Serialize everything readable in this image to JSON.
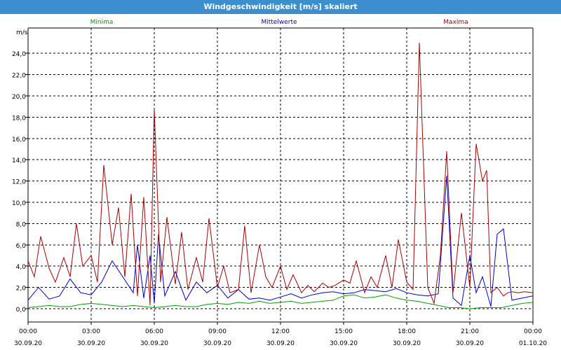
{
  "window": {
    "title": "Windgeschwindigkeit [m/s] skaliert"
  },
  "colors": {
    "minima": "#00a000",
    "mittel": "#0000cc",
    "maxima": "#aa0000"
  },
  "chart_data": {
    "type": "line",
    "title": "Windgeschwindigkeit [m/s] skaliert",
    "ylabel": "m/s",
    "xlabel": "",
    "ylim": [
      0,
      24
    ],
    "y_ticks": [
      "0,0",
      "2,0",
      "4,0",
      "6,0",
      "8,0",
      "10,0",
      "12,0",
      "14,0",
      "16,0",
      "18,0",
      "20,0",
      "22,0",
      "24,0"
    ],
    "x_ticks": [
      {
        "time": "00:00",
        "date": "30.09.20"
      },
      {
        "time": "03:00",
        "date": "30.09.20"
      },
      {
        "time": "06:00",
        "date": "30.09.20"
      },
      {
        "time": "09:00",
        "date": "30.09.20"
      },
      {
        "time": "12:00",
        "date": "30.09.20"
      },
      {
        "time": "15:00",
        "date": "30.09.20"
      },
      {
        "time": "18:00",
        "date": "30.09.20"
      },
      {
        "time": "21:00",
        "date": "30.09.20"
      },
      {
        "time": "00:00",
        "date": "01.10.20"
      }
    ],
    "x_unit": "hours since 30.09.20 00:00",
    "grid": true,
    "series": [
      {
        "name": "Minima",
        "x": [
          0,
          0.5,
          1,
          1.5,
          2,
          2.5,
          3,
          3.5,
          4,
          4.5,
          5,
          5.5,
          6,
          6.5,
          7,
          7.5,
          8,
          8.5,
          9,
          9.5,
          10,
          10.5,
          11,
          11.5,
          12,
          12.5,
          13,
          13.5,
          14,
          14.5,
          15,
          15.5,
          16,
          16.5,
          17,
          17.5,
          18,
          18.5,
          19,
          19.5,
          20,
          20.5,
          21,
          21.5,
          22,
          22.5,
          23,
          23.5,
          24
        ],
        "values": [
          0.1,
          0.2,
          0.3,
          0.2,
          0.2,
          0.4,
          0.5,
          0.4,
          0.3,
          0.2,
          0.3,
          0.2,
          0.1,
          0.2,
          0.3,
          0.2,
          0.2,
          0.4,
          0.5,
          0.4,
          0.6,
          0.5,
          0.7,
          0.5,
          0.6,
          0.7,
          0.5,
          0.6,
          0.7,
          0.8,
          1.2,
          1.3,
          1.0,
          1.1,
          1.3,
          1.0,
          0.8,
          0.7,
          0.5,
          0.3,
          0.1,
          0.1,
          0.0,
          0.1,
          0.1,
          0.1,
          0.3,
          0.5,
          0.6
        ]
      },
      {
        "name": "Mittelwerte",
        "x": [
          0,
          0.5,
          1,
          1.5,
          2,
          2.5,
          3,
          3.5,
          4,
          4.5,
          5,
          5.2,
          5.5,
          5.8,
          6,
          6.2,
          6.5,
          7,
          7.5,
          8,
          8.5,
          9,
          9.5,
          10,
          10.5,
          11,
          11.5,
          12,
          12.5,
          13,
          13.5,
          14,
          14.5,
          15,
          15.5,
          16,
          16.5,
          17,
          17.5,
          18,
          18.5,
          19,
          19.5,
          19.9,
          20.2,
          20.6,
          21,
          21.3,
          21.6,
          22,
          22.3,
          22.6,
          23,
          23.5,
          24
        ],
        "values": [
          0.8,
          2.0,
          0.9,
          1.2,
          2.8,
          1.5,
          1.3,
          2.5,
          4.5,
          3.0,
          1.5,
          6.0,
          1.0,
          5.0,
          0.5,
          7.0,
          1.2,
          3.5,
          0.8,
          2.5,
          1.5,
          2.2,
          1.0,
          1.8,
          0.9,
          1.0,
          0.8,
          1.1,
          1.4,
          1.0,
          1.3,
          1.5,
          1.6,
          1.4,
          1.5,
          1.8,
          1.7,
          1.6,
          1.9,
          1.5,
          1.3,
          1.2,
          1.4,
          12.5,
          1.0,
          0.3,
          5.0,
          1.5,
          3.0,
          0.2,
          7.0,
          7.5,
          0.8,
          1.0,
          1.2
        ]
      },
      {
        "name": "Maxima",
        "x": [
          0,
          0.3,
          0.6,
          1,
          1.3,
          1.7,
          2,
          2.3,
          2.6,
          3,
          3.3,
          3.6,
          4,
          4.3,
          4.6,
          4.9,
          5.2,
          5.5,
          5.8,
          6,
          6.3,
          6.6,
          7,
          7.3,
          7.6,
          8,
          8.3,
          8.6,
          9,
          9.3,
          9.6,
          10,
          10.3,
          10.6,
          11,
          11.3,
          11.6,
          12,
          12.3,
          12.6,
          13,
          13.3,
          13.6,
          14,
          14.3,
          14.6,
          15,
          15.3,
          15.6,
          16,
          16.3,
          16.6,
          17,
          17.3,
          17.6,
          18,
          18.3,
          18.6,
          19,
          19.3,
          19.6,
          19.9,
          20.2,
          20.6,
          21,
          21.3,
          21.6,
          21.8,
          22,
          22.3,
          22.6,
          22.8,
          23,
          23.3,
          23.6,
          24
        ],
        "values": [
          4.5,
          3.0,
          6.8,
          3.8,
          2.5,
          4.8,
          3.0,
          8.0,
          4.0,
          5.0,
          2.5,
          13.5,
          6.0,
          9.5,
          3.0,
          10.8,
          1.2,
          10.5,
          0.3,
          18.8,
          2.5,
          8.6,
          2.3,
          7.2,
          1.8,
          4.8,
          2.5,
          8.5,
          2.0,
          4.0,
          1.5,
          1.8,
          7.8,
          1.5,
          6.0,
          3.0,
          2.0,
          4.0,
          1.8,
          3.2,
          1.5,
          2.2,
          1.6,
          2.4,
          2.0,
          2.2,
          2.7,
          2.4,
          4.5,
          1.5,
          3.0,
          2.0,
          5.0,
          2.0,
          6.5,
          2.5,
          1.8,
          25.0,
          2.0,
          0.5,
          5.0,
          14.8,
          1.5,
          9.0,
          2.0,
          15.5,
          12.0,
          13.0,
          1.5,
          2.0,
          1.2,
          1.5,
          1.6,
          1.5,
          1.6,
          1.5
        ]
      }
    ]
  }
}
